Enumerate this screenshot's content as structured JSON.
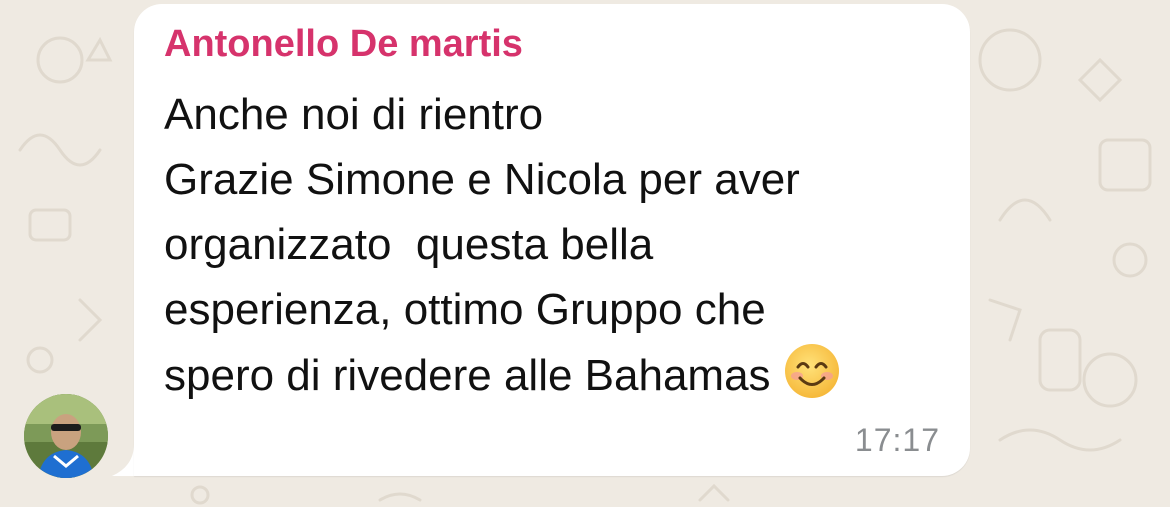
{
  "message": {
    "sender": "Antonello De martis",
    "sender_color": "#d6336c",
    "lines": [
      "Anche noi di rientro",
      "Grazie Simone e Nicola per aver",
      "organizzato  questa bella",
      "esperienza, ottimo Gruppo che",
      "spero di rivedere alle Bahamas"
    ],
    "emoji": "smiling-face-icon",
    "time": "17:17"
  },
  "colors": {
    "chat_background": "#efeae2",
    "bubble": "#ffffff",
    "timestamp": "#8a8d90"
  }
}
